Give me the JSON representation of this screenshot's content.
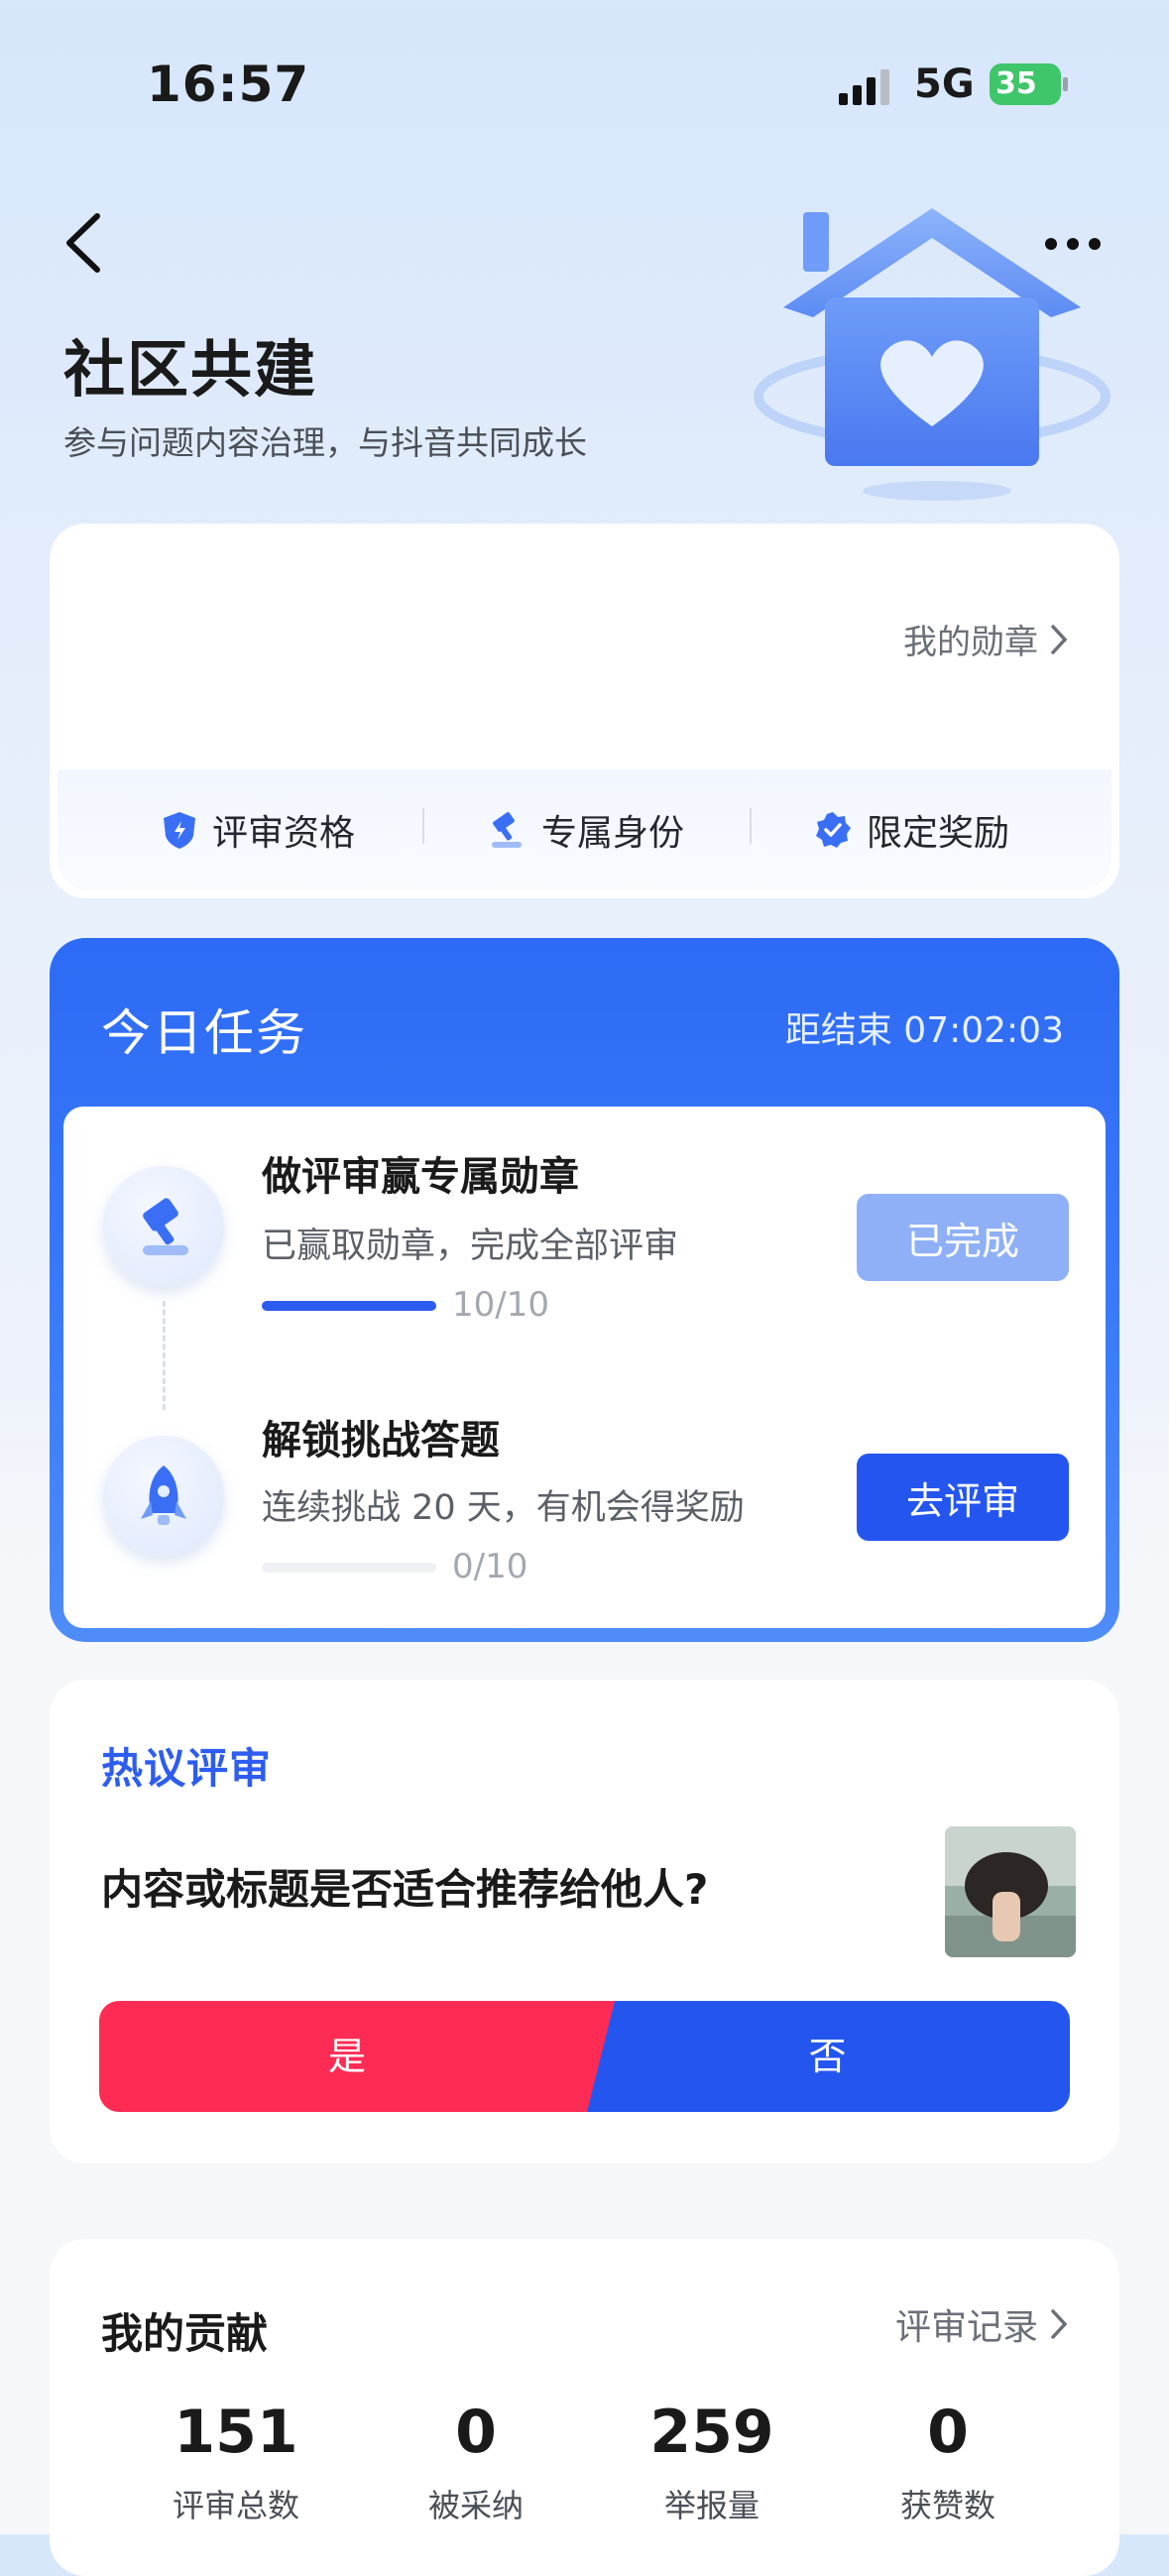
{
  "status": {
    "time": "16:57",
    "network": "5G",
    "battery": "35"
  },
  "header": {
    "title": "社区共建",
    "subtitle": "参与问题内容治理，与抖音共同成长"
  },
  "badge_card": {
    "link": "我的勋章",
    "perks": [
      "评审资格",
      "专属身份",
      "限定奖励"
    ]
  },
  "tasks": {
    "title": "今日任务",
    "countdown": "距结束 07:02:03",
    "items": [
      {
        "name": "做评审赢专属勋章",
        "desc": "已赢取勋章，完成全部评审",
        "progress": 1.0,
        "count": "10/10",
        "button": "已完成",
        "button_color": "#8fb0f6",
        "icon": "gavel-icon"
      },
      {
        "name": "解锁挑战答题",
        "desc": "连续挑战 20 天，有机会得奖励",
        "progress": 0.0,
        "count": "0/10",
        "button": "去评审",
        "button_color": "#2456ef",
        "icon": "rocket-icon"
      }
    ]
  },
  "hot": {
    "label": "热议评审",
    "question": "内容或标题是否适合推荐给他人?",
    "yes": "是",
    "no": "否",
    "yes_color": "#fe2c55",
    "no_color": "#2456ef"
  },
  "contribution": {
    "title": "我的贡献",
    "link": "评审记录",
    "stats": [
      {
        "value": "151",
        "label": "评审总数"
      },
      {
        "value": "0",
        "label": "被采纳"
      },
      {
        "value": "259",
        "label": "举报量"
      },
      {
        "value": "0",
        "label": "获赞数"
      }
    ]
  }
}
